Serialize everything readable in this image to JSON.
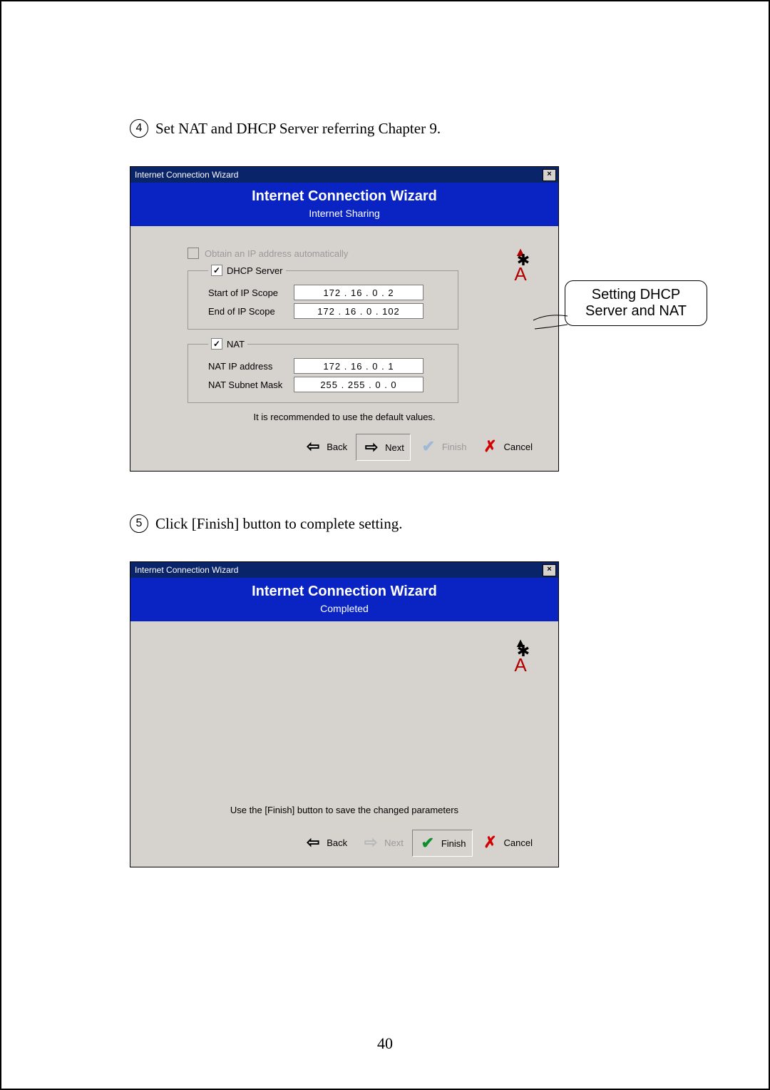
{
  "page_number": "40",
  "step4": {
    "num": "4",
    "text": "Set NAT and DHCP Server referring Chapter 9."
  },
  "step5": {
    "num": "5",
    "text": "Click [Finish] button to complete setting."
  },
  "callout": "Setting DHCP Server and NAT",
  "dialog1": {
    "titlebar": "Internet Connection Wizard",
    "banner_title": "Internet Connection Wizard",
    "banner_sub": "Internet Sharing",
    "obtain_label": "Obtain an IP address automatically",
    "dhcp_legend": "DHCP Server",
    "dhcp_start_label": "Start of IP Scope",
    "dhcp_start_value": "172  .  16   .   0    .    2",
    "dhcp_end_label": "End of IP Scope",
    "dhcp_end_value": "172  .  16   .   0    .  102",
    "nat_legend": "NAT",
    "nat_ip_label": "NAT IP address",
    "nat_ip_value": "172  .  16   .   0    .    1",
    "nat_mask_label": "NAT Subnet Mask",
    "nat_mask_value": "255  . 255  .   0    .    0",
    "recommend": "It is recommended to use the default values.",
    "btn_back": "Back",
    "btn_next": "Next",
    "btn_finish": "Finish",
    "btn_cancel": "Cancel"
  },
  "dialog2": {
    "titlebar": "Internet Connection Wizard",
    "banner_title": "Internet Connection Wizard",
    "banner_sub": "Completed",
    "message": "Use the [Finish] button to save the changed parameters",
    "btn_back": "Back",
    "btn_next": "Next",
    "btn_finish": "Finish",
    "btn_cancel": "Cancel"
  }
}
